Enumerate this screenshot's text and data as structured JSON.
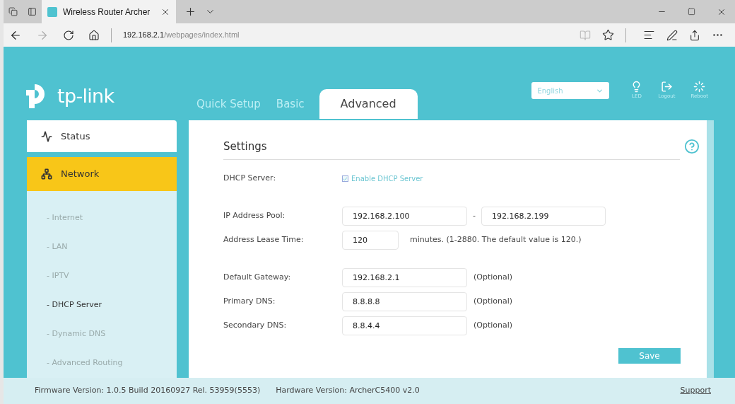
{
  "browser": {
    "tabs": [
      {
        "title": "Wireless Router Archer",
        "selected": true
      }
    ],
    "url": {
      "host": "192.168.2.1",
      "path": "/webpages/index.html"
    }
  },
  "header": {
    "logo": "tp-link",
    "nav": [
      {
        "label": "Quick Setup",
        "selected": false
      },
      {
        "label": "Basic",
        "selected": false
      },
      {
        "label": "Advanced",
        "selected": true
      }
    ],
    "language": "English",
    "actions": [
      {
        "label": "LED",
        "kind": "led"
      },
      {
        "label": "Logout",
        "kind": "logout"
      },
      {
        "label": "Reboot",
        "kind": "reboot"
      }
    ]
  },
  "sidebar": [
    {
      "label": "Status",
      "kind": "status",
      "selected": false
    },
    {
      "label": "Network",
      "kind": "network",
      "selected": true,
      "children": [
        {
          "label": "- Internet",
          "selected": false
        },
        {
          "label": "- LAN",
          "selected": false
        },
        {
          "label": "- IPTV",
          "selected": false
        },
        {
          "label": "- DHCP Server",
          "selected": true
        },
        {
          "label": "- Dynamic DNS",
          "selected": false
        },
        {
          "label": "- Advanced Routing",
          "selected": false
        }
      ]
    }
  ],
  "settings": {
    "title": "Settings",
    "groups": [
      [
        {
          "kind": "checkbox",
          "label": "DHCP Server:",
          "option": "Enable DHCP Server",
          "checked": true
        }
      ],
      [
        {
          "kind": "range",
          "label": "IP Address Pool:",
          "from": "192.168.2.100",
          "separator": "-",
          "to": "192.168.2.199"
        },
        {
          "kind": "short",
          "label": "Address Lease Time:",
          "value": "120",
          "note": "minutes. (1-2880. The default value is 120.)"
        }
      ],
      [
        {
          "kind": "field",
          "label": "Default Gateway:",
          "value": "192.168.2.1",
          "note": "(Optional)"
        },
        {
          "kind": "field",
          "label": "Primary DNS:",
          "value": "8.8.8.8",
          "note": "(Optional)"
        },
        {
          "kind": "field",
          "label": "Secondary DNS:",
          "value": "8.8.4.4",
          "note": "(Optional)"
        }
      ]
    ],
    "save": "Save"
  },
  "footer": {
    "firmware": "Firmware Version: 1.0.5 Build 20160927 Rel. 53959(5553)",
    "hardware": "Hardware Version: ArcherC5400 v2.0",
    "support": "Support"
  }
}
